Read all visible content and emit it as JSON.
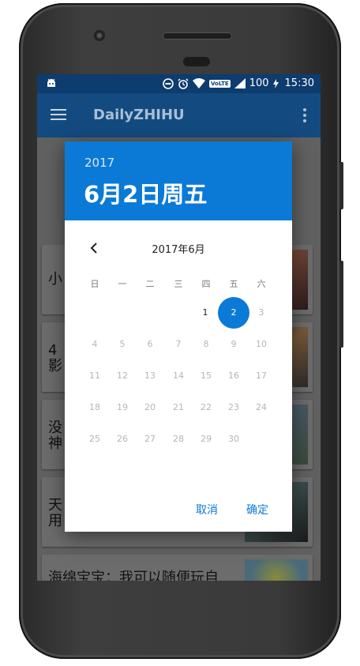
{
  "status_bar": {
    "battery": "100",
    "time": "15:30",
    "volte": "VoLTE",
    "icons": [
      "android-icon",
      "dnd-icon",
      "alarm-icon",
      "wifi-icon",
      "signal-icon",
      "charging-icon"
    ]
  },
  "toolbar": {
    "title": "DailyZHIHU"
  },
  "cards": [
    {
      "title": "小"
    },
    {
      "title": "4\n影"
    },
    {
      "title": "没\n神"
    },
    {
      "title": "天\n用"
    },
    {
      "title": "海绵宝宝：我可以随便玩自"
    }
  ],
  "date_picker": {
    "year": "2017",
    "selected_label": "6月2日周五",
    "month_label": "2017年6月",
    "weekdays": [
      "日",
      "一",
      "二",
      "三",
      "四",
      "五",
      "六"
    ],
    "days": [
      "1",
      "2",
      "3",
      "4",
      "5",
      "6",
      "7",
      "8",
      "9",
      "10",
      "11",
      "12",
      "13",
      "14",
      "15",
      "16",
      "17",
      "18",
      "19",
      "20",
      "21",
      "22",
      "23",
      "24",
      "25",
      "26",
      "27",
      "28",
      "29",
      "30"
    ],
    "selected_day": "2",
    "cancel_label": "取消",
    "ok_label": "确定",
    "accent_color": "#0b7ad6"
  }
}
